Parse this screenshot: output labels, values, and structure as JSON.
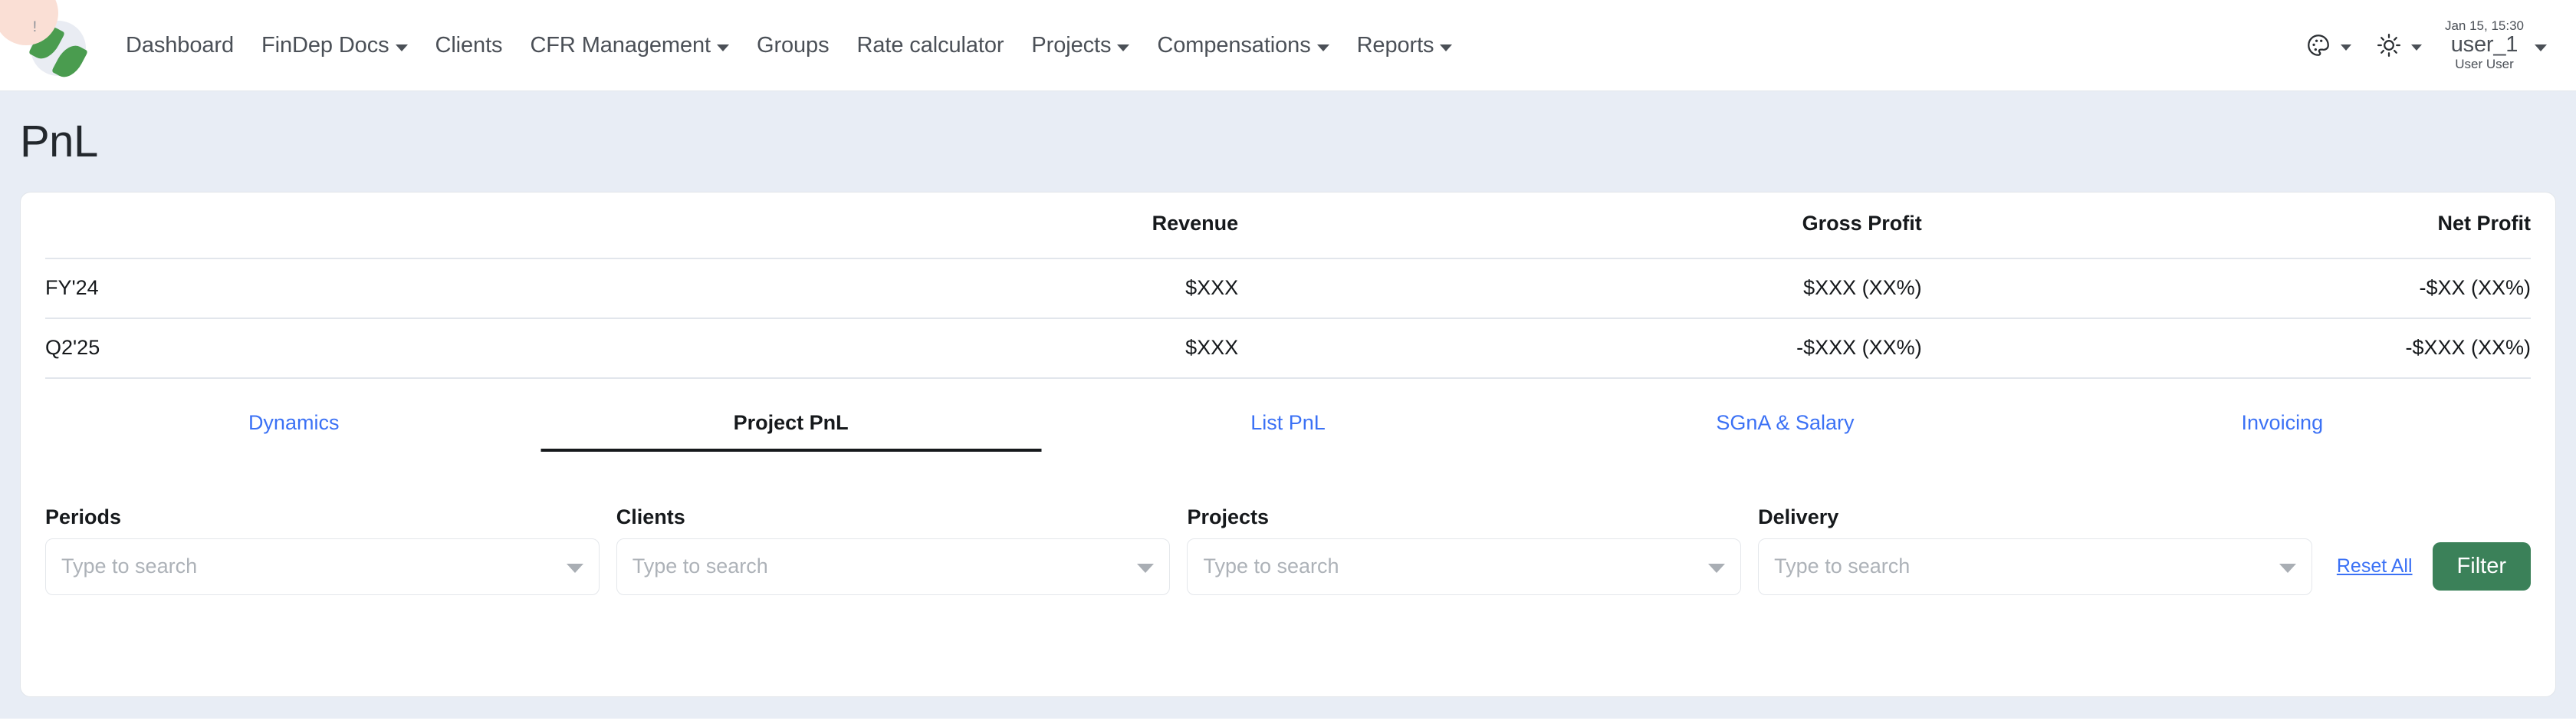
{
  "navbar": {
    "logo_badge_mark": "!",
    "links": [
      {
        "label": "Dashboard",
        "has_caret": false
      },
      {
        "label": "FinDep Docs",
        "has_caret": true
      },
      {
        "label": "Clients",
        "has_caret": false
      },
      {
        "label": "CFR Management",
        "has_caret": true
      },
      {
        "label": "Groups",
        "has_caret": false
      },
      {
        "label": "Rate calculator",
        "has_caret": false
      },
      {
        "label": "Projects",
        "has_caret": true
      },
      {
        "label": "Compensations",
        "has_caret": true
      },
      {
        "label": "Reports",
        "has_caret": true
      }
    ],
    "theme_picker_icon": "palette-icon",
    "brightness_icon": "sun-icon",
    "user": {
      "datetime": "Jan 15, 15:30",
      "username": "user_1",
      "fullname": "User User"
    }
  },
  "page": {
    "title": "PnL",
    "banner_color": "#e8edf5"
  },
  "summary_table": {
    "columns": [
      "",
      "Revenue",
      "Gross Profit",
      "Net Profit"
    ],
    "rows": [
      {
        "period": "FY'24",
        "revenue": "$XXX",
        "gross_profit": "$XXX (XX%)",
        "net_profit": "-$XX (XX%)"
      },
      {
        "period": "Q2'25",
        "revenue": "$XXX",
        "gross_profit": "-$XXX (XX%)",
        "net_profit": "-$XXX (XX%)"
      }
    ]
  },
  "tabs": [
    {
      "label": "Dynamics",
      "active": false
    },
    {
      "label": "Project PnL",
      "active": true
    },
    {
      "label": "List PnL",
      "active": false
    },
    {
      "label": "SGnA & Salary",
      "active": false
    },
    {
      "label": "Invoicing",
      "active": false
    }
  ],
  "filters": {
    "fields": [
      {
        "label": "Periods",
        "placeholder": "Type to search",
        "value": ""
      },
      {
        "label": "Clients",
        "placeholder": "Type to search",
        "value": ""
      },
      {
        "label": "Projects",
        "placeholder": "Type to search",
        "value": ""
      },
      {
        "label": "Delivery",
        "placeholder": "Type to search",
        "value": ""
      }
    ],
    "reset_label": "Reset All",
    "filter_label": "Filter",
    "filter_button_color": "#3b8159",
    "link_color": "#3b71f5"
  }
}
